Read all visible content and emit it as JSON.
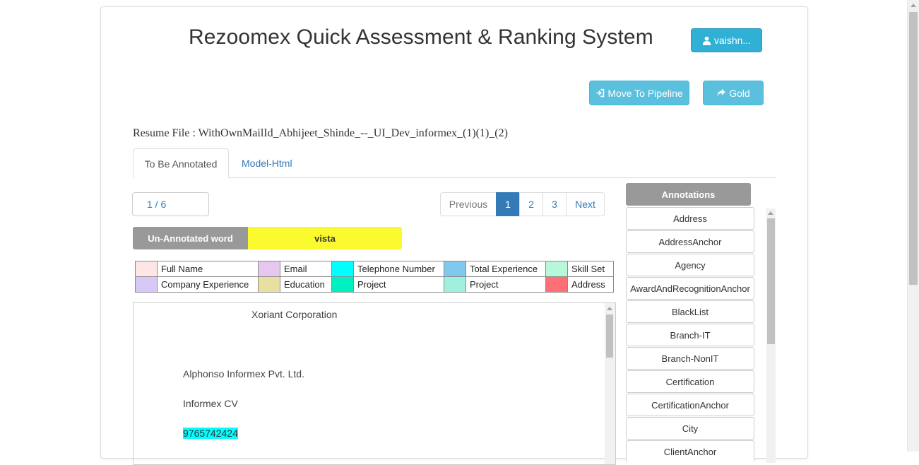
{
  "header": {
    "title": "Rezoomex Quick Assessment & Ranking System",
    "user_label": "vaishn...",
    "move_to_pipeline_label": "Move To Pipeline",
    "gold_label": "Gold"
  },
  "resume_file": "Resume File : WithOwnMailId_Abhijeet_Shinde_--_UI_Dev_informex_(1)(1)_(2)",
  "tabs": [
    {
      "label": "To Be Annotated",
      "active": true
    },
    {
      "label": "Model-Html",
      "active": false
    }
  ],
  "page_counter": "1 / 6",
  "pagination": {
    "previous": "Previous",
    "pages": [
      "1",
      "2",
      "3"
    ],
    "current": "1",
    "next": "Next"
  },
  "unannotated": {
    "label": "Un-Annotated word",
    "word": "vista",
    "word_color": "#fafa2e"
  },
  "legend": [
    [
      {
        "label": "Full Name",
        "color": "#ffe6e6"
      },
      {
        "label": "Email",
        "color": "#e6c8ee"
      },
      {
        "label": "Telephone Number",
        "color": "#00ffff"
      },
      {
        "label": "Total Experience",
        "color": "#80c8ee"
      },
      {
        "label": "Skill Set",
        "color": "#b8f8d8"
      }
    ],
    [
      {
        "label": "Company Experience",
        "color": "#d8c8f8"
      },
      {
        "label": "Education",
        "color": "#e8e0a0"
      },
      {
        "label": "Project",
        "color": "#00f0c0"
      },
      {
        "label": "Project",
        "color": "#a0f0e0"
      },
      {
        "label": "Address",
        "color": "#ff6f78"
      }
    ]
  ],
  "document_lines": [
    "Xoriant Corporation",
    "Alphonso Informex Pvt. Ltd.",
    "Informex CV",
    "9765742424"
  ],
  "annotations": {
    "header": "Annotations",
    "items": [
      "Address",
      "AddressAnchor",
      "Agency",
      "AwardAndRecognitionAnchor",
      "BlackList",
      "Branch-IT",
      "Branch-NonIT",
      "Certification",
      "CertificationAnchor",
      "City",
      "ClientAnchor"
    ]
  },
  "icons": {
    "user": "user-icon",
    "move": "sign-in-icon",
    "gold": "share-icon"
  }
}
